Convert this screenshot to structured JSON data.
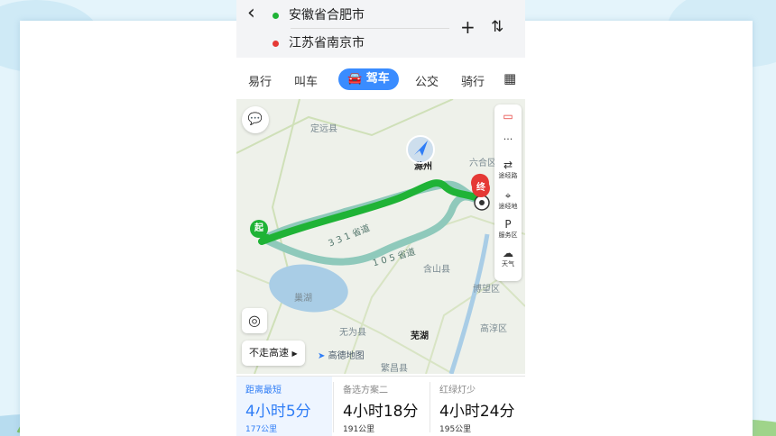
{
  "route": {
    "origin": "安徽省合肥市",
    "destination": "江苏省南京市",
    "add_label": "+",
    "swap_label": "⇅"
  },
  "modes": [
    {
      "label": "易行"
    },
    {
      "label": "叫车"
    },
    {
      "label": "驾车",
      "active": true
    },
    {
      "label": "公交"
    },
    {
      "label": "骑行"
    }
  ],
  "map": {
    "labels": {
      "dingyuan": "定远县",
      "chuzhou": "滁州",
      "liuhe": "六合区",
      "hanshan": "含山县",
      "bowang": "博望区",
      "gaochun": "高淳区",
      "chaohu": "巢湖",
      "wuwei": "无为县",
      "wuhu": "芜湖",
      "fanchang": "繁昌县",
      "road_s331": "3 3 1 省道",
      "road_s105": "1 0 5 省道"
    },
    "start_marker": "起",
    "end_marker": "终",
    "avoid_highway_label": "不走高速",
    "brand": "高德地图",
    "colors": {
      "primary_route": "#1fb336",
      "alt_route": "#8fc9bb",
      "lake": "#a9cde6"
    }
  },
  "side_tools": {
    "traffic": "traffic-light-icon",
    "more": "···",
    "waypoint_route": "途经路",
    "waypoint_place": "途经地",
    "service_area": "服务区",
    "weather": "天气"
  },
  "options": [
    {
      "tag": "距离最短",
      "time": "4小时5分",
      "distance": "177公里",
      "selected": true
    },
    {
      "tag": "备选方案二",
      "time": "4小时18分",
      "distance": "191公里"
    },
    {
      "tag": "红绿灯少",
      "time": "4小时24分",
      "distance": "195公里"
    }
  ]
}
